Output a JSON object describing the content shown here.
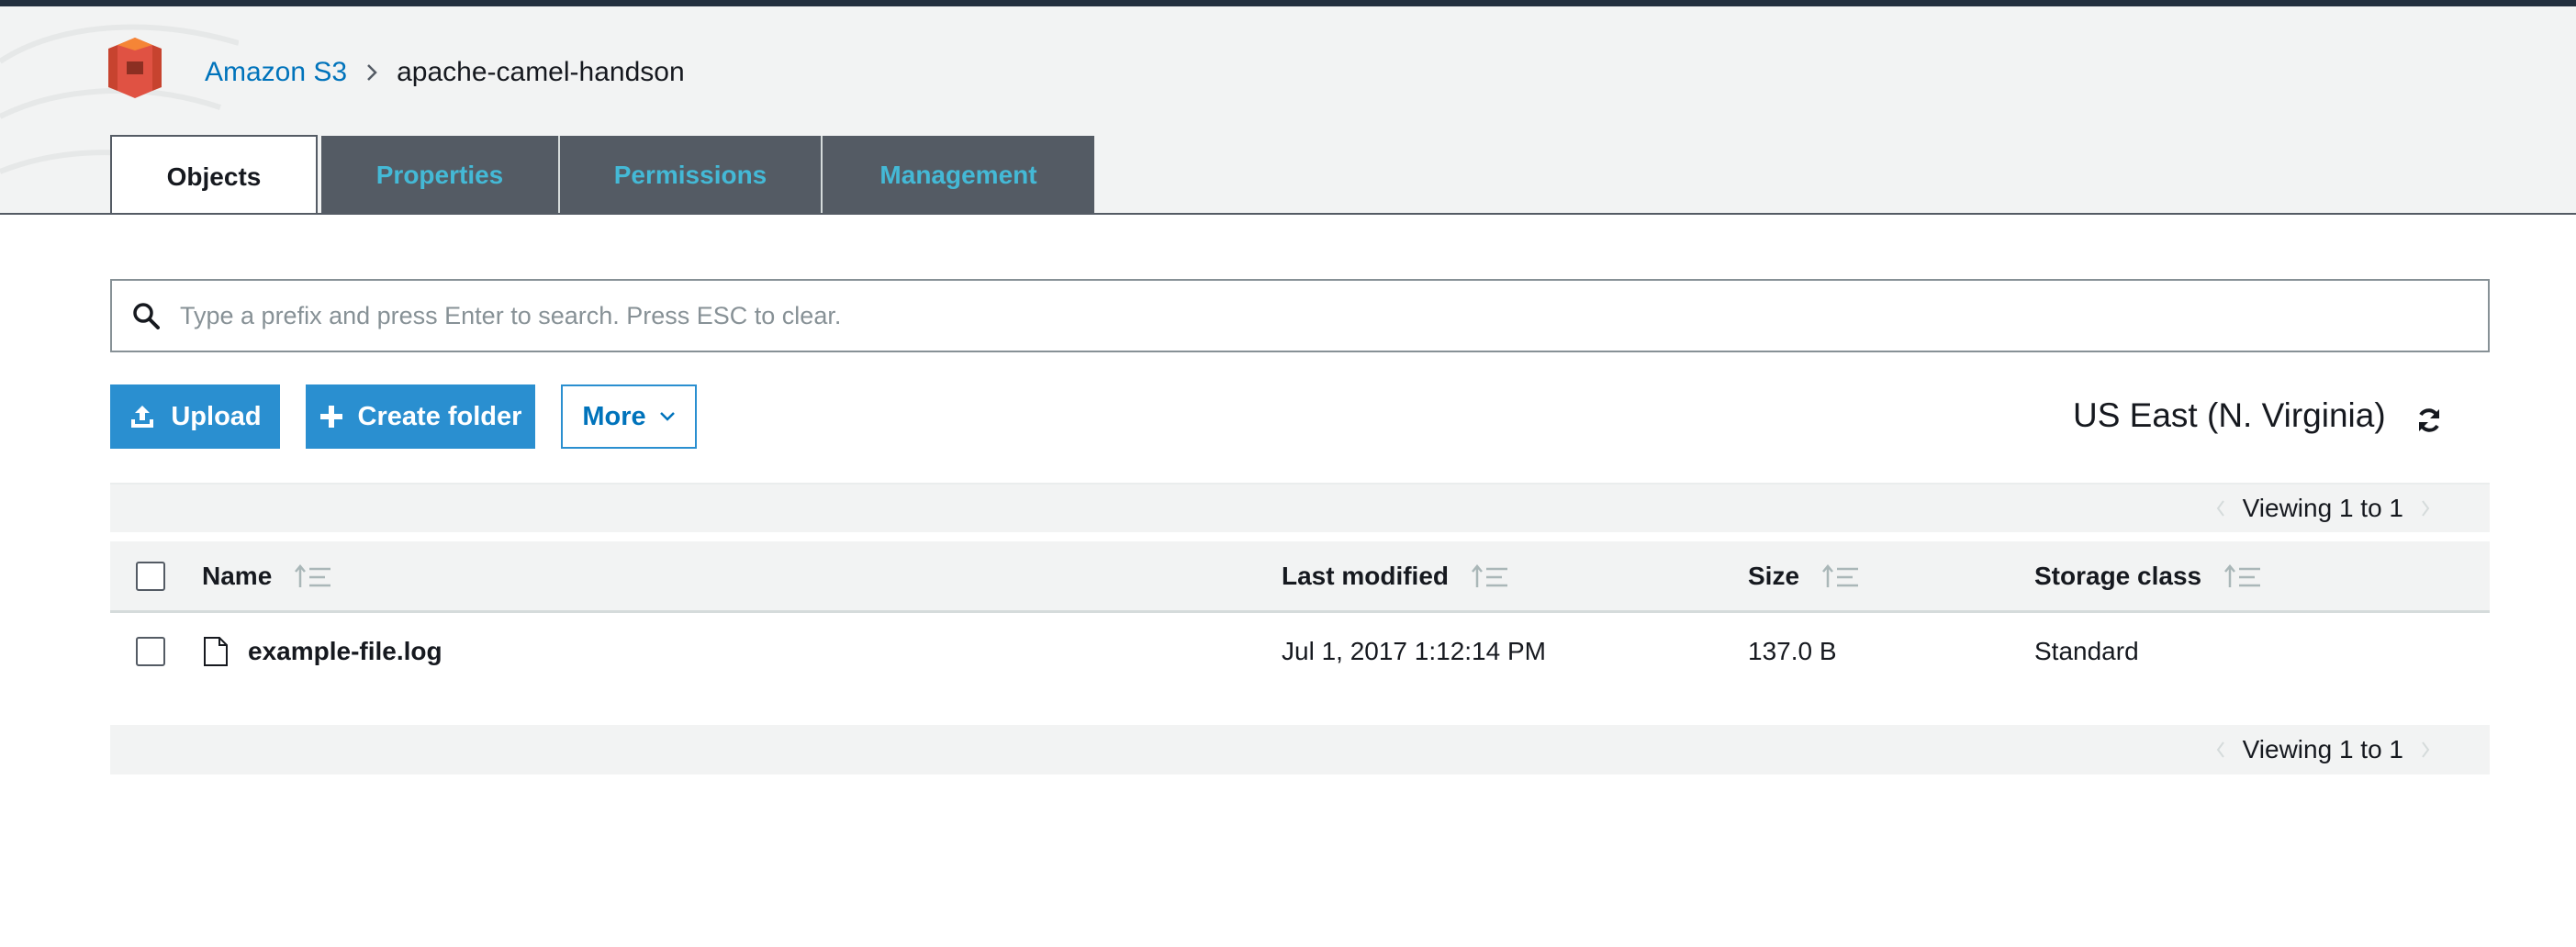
{
  "breadcrumb": {
    "root": "Amazon S3",
    "current": "apache-camel-handson"
  },
  "tabs": {
    "objects": "Objects",
    "properties": "Properties",
    "permissions": "Permissions",
    "management": "Management"
  },
  "search": {
    "placeholder": "Type a prefix and press Enter to search. Press ESC to clear."
  },
  "toolbar": {
    "upload_label": "Upload",
    "create_folder_label": "Create folder",
    "more_label": "More"
  },
  "region": "US East (N. Virginia)",
  "pagination": {
    "top_text": "Viewing 1 to 1",
    "bottom_text": "Viewing 1 to 1"
  },
  "table": {
    "headers": {
      "name": "Name",
      "last_modified": "Last modified",
      "size": "Size",
      "storage_class": "Storage class"
    },
    "rows": [
      {
        "name": "example-file.log",
        "last_modified": "Jul 1, 2017 1:12:14 PM",
        "size": "137.0 B",
        "storage_class": "Standard"
      }
    ]
  },
  "colors": {
    "accent_blue": "#2a8fd0",
    "link_blue": "#0073bb",
    "tab_bg": "#545b64",
    "tab_text": "#44b9d6",
    "logo_red": "#e05243"
  },
  "icons": {
    "logo": "s3-bucket-icon",
    "breadcrumb_separator": "chevron-right-icon",
    "search": "search-icon",
    "upload": "upload-icon",
    "create_folder": "plus-icon",
    "more": "chevron-down-icon",
    "refresh": "refresh-icon",
    "sort": "sort-icon",
    "file": "file-icon"
  }
}
